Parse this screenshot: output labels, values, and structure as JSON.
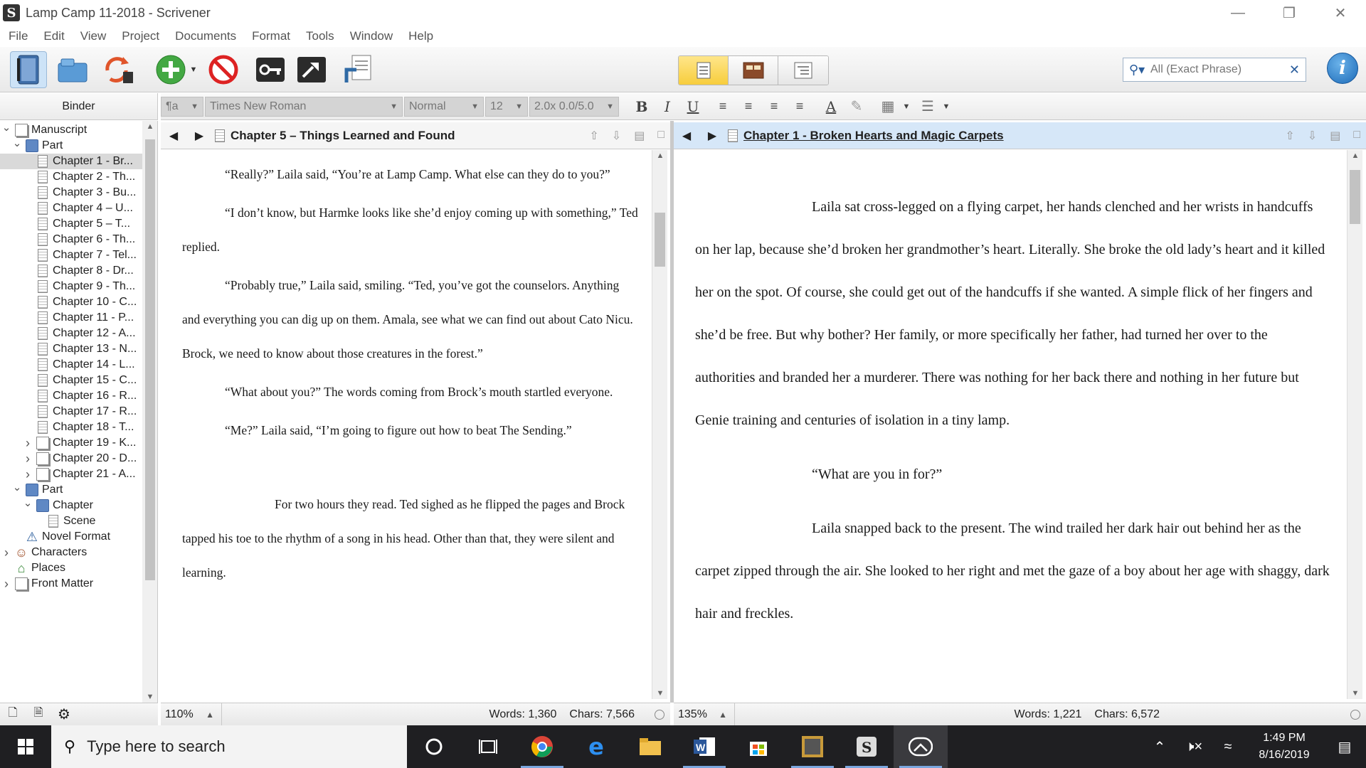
{
  "window": {
    "title": "Lamp Camp 11-2018 - Scrivener"
  },
  "menu": [
    "File",
    "Edit",
    "View",
    "Project",
    "Documents",
    "Format",
    "Tools",
    "Window",
    "Help"
  ],
  "search": {
    "placeholder": "All (Exact Phrase)"
  },
  "binder": {
    "header": "Binder",
    "items": [
      {
        "label": "Manuscript",
        "indent": 0,
        "twisty": "open",
        "icon": "stack"
      },
      {
        "label": "Part",
        "indent": 1,
        "twisty": "open",
        "icon": "folder"
      },
      {
        "label": "Chapter 1 - Br...",
        "indent": 2,
        "twisty": "",
        "icon": "doc",
        "selected": true
      },
      {
        "label": "Chapter 2 - Th...",
        "indent": 2,
        "twisty": "",
        "icon": "doc"
      },
      {
        "label": "Chapter 3 - Bu...",
        "indent": 2,
        "twisty": "",
        "icon": "doc"
      },
      {
        "label": "Chapter 4 – U...",
        "indent": 2,
        "twisty": "",
        "icon": "doc"
      },
      {
        "label": "Chapter 5 – T...",
        "indent": 2,
        "twisty": "",
        "icon": "doc"
      },
      {
        "label": "Chapter 6 - Th...",
        "indent": 2,
        "twisty": "",
        "icon": "doc"
      },
      {
        "label": "Chapter 7 - Tel...",
        "indent": 2,
        "twisty": "",
        "icon": "doc"
      },
      {
        "label": "Chapter 8 - Dr...",
        "indent": 2,
        "twisty": "",
        "icon": "doc"
      },
      {
        "label": "Chapter 9 - Th...",
        "indent": 2,
        "twisty": "",
        "icon": "doc"
      },
      {
        "label": "Chapter 10 - C...",
        "indent": 2,
        "twisty": "",
        "icon": "doc"
      },
      {
        "label": "Chapter 11 - P...",
        "indent": 2,
        "twisty": "",
        "icon": "doc"
      },
      {
        "label": "Chapter 12 - A...",
        "indent": 2,
        "twisty": "",
        "icon": "doc"
      },
      {
        "label": "Chapter 13 - N...",
        "indent": 2,
        "twisty": "",
        "icon": "doc"
      },
      {
        "label": "Chapter 14 - L...",
        "indent": 2,
        "twisty": "",
        "icon": "doc"
      },
      {
        "label": "Chapter 15 - C...",
        "indent": 2,
        "twisty": "",
        "icon": "doc"
      },
      {
        "label": "Chapter 16 - R...",
        "indent": 2,
        "twisty": "",
        "icon": "doc"
      },
      {
        "label": "Chapter 17 - R...",
        "indent": 2,
        "twisty": "",
        "icon": "doc"
      },
      {
        "label": "Chapter 18 - T...",
        "indent": 2,
        "twisty": "",
        "icon": "doc"
      },
      {
        "label": "Chapter 19 - K...",
        "indent": 2,
        "twisty": "closed",
        "icon": "stack"
      },
      {
        "label": "Chapter 20 - D...",
        "indent": 2,
        "twisty": "closed",
        "icon": "stack"
      },
      {
        "label": "Chapter 21 - A...",
        "indent": 2,
        "twisty": "closed",
        "icon": "stack"
      },
      {
        "label": "Part",
        "indent": 1,
        "twisty": "open",
        "icon": "folder"
      },
      {
        "label": "Chapter",
        "indent": 2,
        "twisty": "open",
        "icon": "folder"
      },
      {
        "label": "Scene",
        "indent": 3,
        "twisty": "",
        "icon": "doc"
      },
      {
        "label": "Novel Format",
        "indent": 1,
        "twisty": "",
        "icon": "warning"
      },
      {
        "label": "Characters",
        "indent": 0,
        "twisty": "closed",
        "icon": "characters"
      },
      {
        "label": "Places",
        "indent": 0,
        "twisty": "",
        "icon": "places"
      },
      {
        "label": "Front Matter",
        "indent": 0,
        "twisty": "closed",
        "icon": "stack"
      }
    ]
  },
  "format_bar": {
    "style": "¶a",
    "font": "Times New Roman",
    "variant": "Normal",
    "size": "12",
    "spacing": "2.0x 0.0/5.0"
  },
  "left_editor": {
    "title": "Chapter 5 – Things Learned and Found",
    "paragraphs": [
      "“Really?” Laila said, “You’re at Lamp Camp. What else can they do to you?”",
      "“I don’t know, but Harmke looks like she’d enjoy coming up with something,” Ted replied.",
      " “Probably true,” Laila said, smiling. “Ted, you’ve got the counselors. Anything and everything you can dig up on them. Amala, see what we can find out about Cato Nicu. Brock, we need to know about those creatures in the forest.”",
      "“What about you?” The words coming from Brock’s mouth startled everyone.",
      "“Me?” Laila said, “I’m going to figure out how to beat The Sending.”",
      "For two hours they read. Ted sighed as he flipped the pages and Brock tapped his toe to the rhythm of a song in his head. Other than that, they were silent and learning."
    ],
    "zoom": "110%",
    "words": "Words: 1,360",
    "chars": "Chars: 7,566"
  },
  "right_editor": {
    "title": "Chapter 1 - Broken Hearts and Magic Carpets",
    "paragraphs": [
      "Laila sat cross-legged on a flying carpet, her hands clenched and her wrists in handcuffs on her lap, because she’d broken her grandmother’s heart. Literally. She broke the old lady’s heart and it killed her on the spot. Of course, she could get out of the handcuffs if she wanted. A simple flick of her fingers and she’d be free. But why bother? Her family, or more specifically her father, had turned her over to the authorities and branded her a murderer. There was nothing for her back there and nothing in her future but Genie training and centuries of isolation in a tiny lamp.",
      "“What are you in for?”",
      "Laila snapped back to the present. The wind trailed her dark hair out behind her as the carpet zipped through the air. She looked to her right and met the gaze of a boy about her age with shaggy, dark hair and freckles."
    ],
    "zoom": "135%",
    "words": "Words: 1,221",
    "chars": "Chars: 6,572"
  },
  "taskbar": {
    "search_placeholder": "Type here to search",
    "time": "1:49 PM",
    "date": "8/16/2019"
  }
}
